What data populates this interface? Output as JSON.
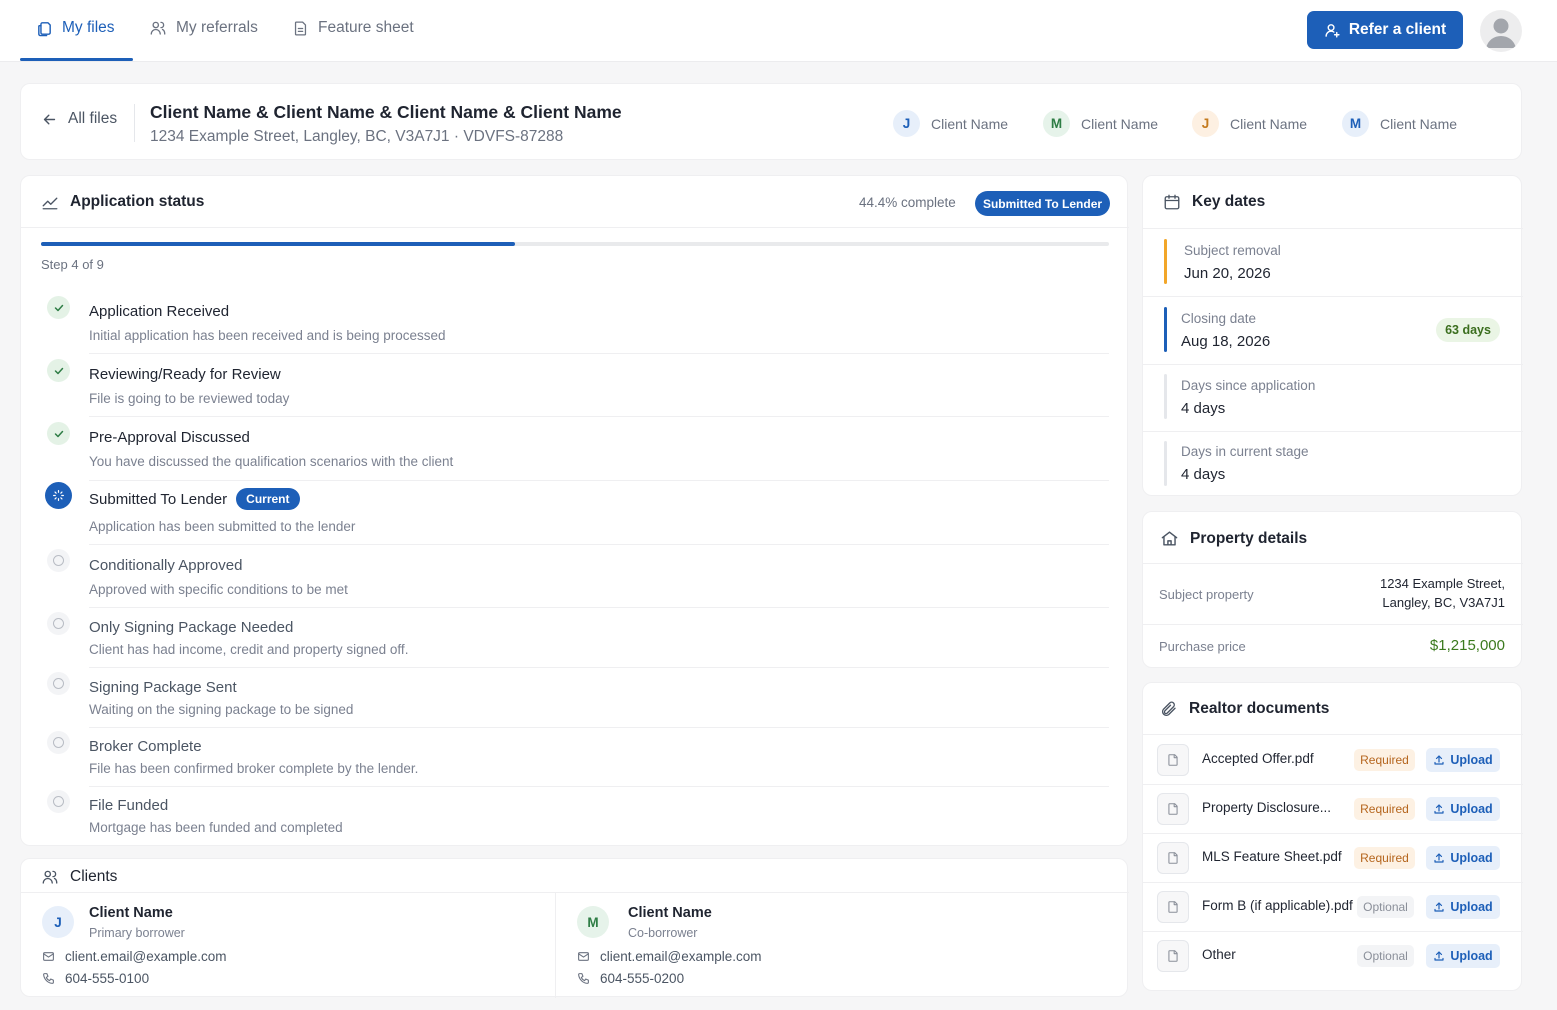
{
  "nav": {
    "tabs": [
      {
        "label": "My files",
        "icon": "files-icon",
        "active": true
      },
      {
        "label": "My referrals",
        "icon": "users-icon",
        "active": false
      },
      {
        "label": "Feature sheet",
        "icon": "document-icon",
        "active": false
      }
    ],
    "refer_label": "Refer a client"
  },
  "file": {
    "back_label": "All files",
    "title": "Client Name & Client Name & Client Name & Client Name",
    "subtitle": "1234 Example Street, Langley, BC, V3A7J1 · VDVFS-87288",
    "clients": [
      {
        "initial": "J",
        "name": "Client Name",
        "color": "#1d5fb8"
      },
      {
        "initial": "M",
        "name": "Client Name",
        "color": "#2e7d45"
      },
      {
        "initial": "J",
        "name": "Client Name",
        "color": "#c47a1d"
      },
      {
        "initial": "M",
        "name": "Client Name",
        "color": "#1d5fb8"
      }
    ]
  },
  "status": {
    "title": "Application status",
    "percent_label": "44.4% complete",
    "progress": 0.444,
    "stage_badge": "Submitted To Lender",
    "step_label": "Step 4 of 9",
    "current_label": "Current",
    "steps": [
      {
        "name": "Application Received",
        "desc": "Initial application has been received and is being processed",
        "state": "done"
      },
      {
        "name": "Reviewing/Ready for Review",
        "desc": "File is going to be reviewed today",
        "state": "done"
      },
      {
        "name": "Pre-Approval Discussed",
        "desc": "You have discussed the qualification scenarios with the client",
        "state": "done"
      },
      {
        "name": "Submitted To Lender",
        "desc": "Application has been submitted to the lender",
        "state": "current"
      },
      {
        "name": "Conditionally Approved",
        "desc": "Approved with specific conditions to be met",
        "state": "pending"
      },
      {
        "name": "Only Signing Package Needed",
        "desc": "Client has had income, credit and property signed off.",
        "state": "pending"
      },
      {
        "name": "Signing Package Sent",
        "desc": "Waiting on the signing package to be signed",
        "state": "pending"
      },
      {
        "name": "Broker Complete",
        "desc": "File has been confirmed broker complete by the lender.",
        "state": "pending"
      },
      {
        "name": "File Funded",
        "desc": "Mortgage has been funded and completed",
        "state": "pending"
      }
    ]
  },
  "clients_section": {
    "title": "Clients",
    "clients": [
      {
        "initial": "J",
        "name": "Client Name",
        "role": "Primary borrower",
        "email": "client.email@example.com",
        "phone": "604-555-0100"
      },
      {
        "initial": "M",
        "name": "Client Name",
        "role": "Co-borrower",
        "email": "client.email@example.com",
        "phone": "604-555-0200"
      }
    ]
  },
  "key_dates": {
    "title": "Key dates",
    "items": [
      {
        "label": "Subject removal",
        "value": "Jun 20, 2026",
        "accent": "#f2a629"
      },
      {
        "label": "Closing date",
        "value": "Aug 18, 2026",
        "accent": "#1d5fb8",
        "pill": "63 days"
      },
      {
        "label": "Days since application",
        "value": "4 days",
        "accent": "#e5e7eb"
      },
      {
        "label": "Days in current stage",
        "value": "4 days",
        "accent": "#e5e7eb"
      }
    ]
  },
  "property": {
    "title": "Property details",
    "subject_label": "Subject property",
    "subject_line1": "1234 Example Street,",
    "subject_line2": "Langley, BC, V3A7J1",
    "price_label": "Purchase price",
    "price": "$1,215,000"
  },
  "realtor_docs": {
    "title": "Realtor documents",
    "upload_label": "Upload",
    "docs": [
      {
        "name": "Accepted Offer.pdf",
        "status": "Required"
      },
      {
        "name": "Property Disclosure...",
        "status": "Required"
      },
      {
        "name": "MLS Feature Sheet.pdf",
        "status": "Required"
      },
      {
        "name": "Form B (if applicable).pdf",
        "status": "Optional"
      },
      {
        "name": "Other",
        "status": "Optional"
      }
    ]
  },
  "colors": {
    "accent": "#1d5fb8",
    "success": "#2e7d45",
    "warning": "#b5651d",
    "price": "#3b7a1e"
  }
}
